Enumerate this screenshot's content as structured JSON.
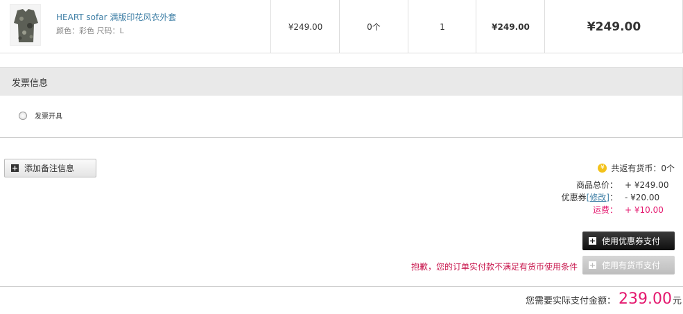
{
  "product": {
    "name": "HEART sofar 满版印花风衣外套",
    "spec": "颜色：彩色 尺码：L",
    "unit_price": "¥249.00",
    "coins": "0个",
    "quantity": "1",
    "subtotal": "¥249.00",
    "total": "¥249.00"
  },
  "invoice": {
    "title": "发票信息",
    "option_label": "发票开具"
  },
  "note": {
    "button_label": "添加备注信息"
  },
  "summary": {
    "coin_icon": "coin-icon",
    "coin_text": "共返有货币：0个",
    "goods_label": "商品总价：",
    "goods_value": "+ ¥249.00",
    "coupon_label": "优惠券",
    "coupon_edit": "[修改]",
    "coupon_colon": "：",
    "coupon_value": "- ¥20.00",
    "shipping_label": "运费：",
    "shipping_value": "+ ¥10.00"
  },
  "pay": {
    "coupon_button": "使用优惠券支付",
    "coin_button": "使用有货币支付",
    "warning": "抱歉，您的订单实付款不满足有货币使用条件"
  },
  "total": {
    "label": "您需要实际支付金额：",
    "amount": "239.00",
    "unit": "元"
  },
  "colors": {
    "accent_pink": "#e4196f",
    "link_blue": "#3f7fa6",
    "warning_red": "#c8174d"
  }
}
